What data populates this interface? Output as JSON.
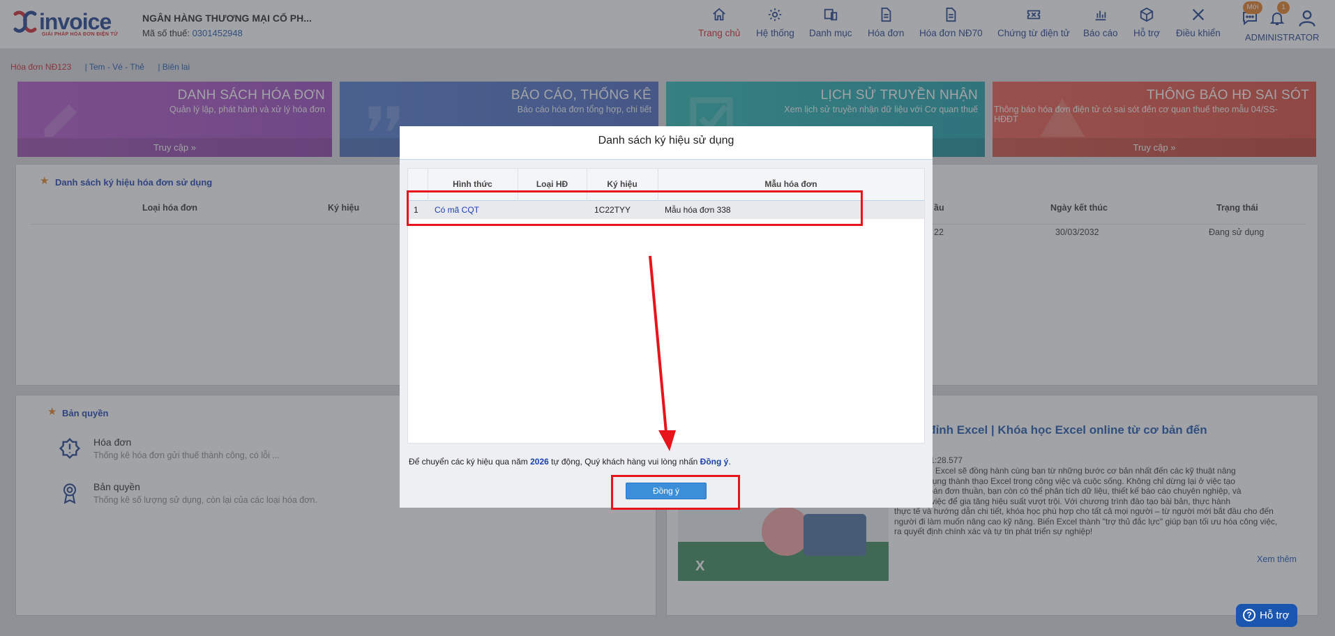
{
  "header": {
    "logo_text": "invoice",
    "logo_tagline": "GIẢI PHÁP HÓA ĐƠN ĐIỆN TỬ",
    "company_name": "NGÂN HÀNG THƯƠNG MẠI CỔ PH...",
    "tax_label": "Mã số thuế:",
    "tax_value": "0301452948",
    "nav": [
      {
        "label": "Trang chủ",
        "icon": "home-icon"
      },
      {
        "label": "Hệ thống",
        "icon": "gear-icon"
      },
      {
        "label": "Danh mục",
        "icon": "catalog-icon"
      },
      {
        "label": "Hóa đơn",
        "icon": "document-icon"
      },
      {
        "label": "Hóa đơn NĐ70",
        "icon": "document-icon"
      },
      {
        "label": "Chứng từ điện tử",
        "icon": "ticket-icon"
      },
      {
        "label": "Báo cáo",
        "icon": "bar-chart-icon"
      },
      {
        "label": "Hỗ trợ",
        "icon": "cube-icon"
      },
      {
        "label": "Điều khiển",
        "icon": "tools-icon"
      }
    ],
    "messages_badge": "Mới",
    "notifications_badge": "1",
    "user_label": "ADMINISTRATOR"
  },
  "tabs": [
    "Hóa đơn NĐ123",
    "| Tem - Vé - Thẻ",
    "| Biên lai"
  ],
  "tiles": [
    {
      "title": "DANH SÁCH HÓA ĐƠN",
      "desc": "Quản lý lập, phát hành và xử lý hóa đơn",
      "footer": "Truy cập",
      "color": "#a74fc4"
    },
    {
      "title": "BÁO CÁO, THỐNG KÊ",
      "desc": "Báo cáo hóa đơn tổng hợp, chi tiết",
      "footer": "",
      "color": "#4a70c6"
    },
    {
      "title": "LỊCH SỬ TRUYỀN NHẬN",
      "desc": "Xem lịch sử truyền nhận dữ liệu với Cơ quan thuế",
      "footer": "",
      "color": "#1fa9ae"
    },
    {
      "title": "THÔNG BÁO HĐ SAI SÓT",
      "desc": "Thông báo hóa đơn điện tử có sai sót đến cơ quan thuế theo mẫu 04/SS-HĐĐT",
      "footer": "Truy cập",
      "color": "#e1533f"
    }
  ],
  "symbols_panel": {
    "title": "Danh sách ký hiệu hóa đơn sử dụng",
    "columns": [
      "Loại hóa đơn",
      "Ký hiệu",
      "ầu",
      "Ngày kết thúc",
      "Trạng thái"
    ],
    "row": {
      "start_partial": "22",
      "end": "30/03/2032",
      "status": "Đang sử dụng"
    }
  },
  "license_panel": {
    "title": "Bản quyền",
    "items": [
      {
        "title": "Hóa đơn",
        "desc": "Thống kê hóa đơn gửi thuế thành công, có lỗi ..."
      },
      {
        "title": "Bản quyền",
        "desc": "Thống kê số lượng sử dụng, còn lại của các loại hóa đơn."
      }
    ]
  },
  "news": {
    "title": ": Tuyệt đỉnh Excel | Khóa học Excel online từ cơ bản đến\nao",
    "date": "04-29T14:51:28.577",
    "body": "Tuyệt đỉnh Excel sẽ đồng hành cùng bạn từ những bước cơ bản nhất đến các kỹ thuật nâng\nbán ứng dụng thành thạo Excel trong công việc và cuộc sống. Không chỉ dừng lại ở việc tạo\nhay tính toán đơn thuần, bạn còn có thể phân tích dữ liệu, thiết kế báo cáo chuyên nghiệp, và\nhóa công việc để gia tăng hiệu suất vượt trội. Với chương trình đào tạo bài bản, thực hành\nthực tế và hướng dẫn chi tiết, khóa học phù hợp cho tất cả mọi người – từ người mới bắt đầu cho đến\nngười đi làm muốn nâng cao kỹ năng. Biến Excel thành \"trợ thủ đắc lực\" giúp bạn tối ưu hóa công việc,\nra quyết định chính xác và tự tin phát triển sự nghiệp!",
    "more": "Xem thêm"
  },
  "modal": {
    "title": "Danh sách ký hiệu sử dụng",
    "columns": [
      "Hình thức",
      "Loại HĐ",
      "Ký hiệu",
      "Mẫu hóa đơn"
    ],
    "rows": [
      {
        "index": "1",
        "form": "Có mã CQT",
        "type": "",
        "symbol": "1C22TYY",
        "template": "Mẫu hóa đơn 338"
      }
    ],
    "note_prefix": "Để chuyển các ký hiệu qua năm ",
    "note_year": "2026",
    "note_middle": " tự động, Quý khách hàng vui lòng nhấn ",
    "note_action": "Đồng ý",
    "note_suffix": ".",
    "ok_label": "Đồng ý"
  },
  "help_button": "Hỗ trợ",
  "colors": {
    "brand": "#1b3c8f",
    "accent": "#d1232a",
    "annotation": "#e8141c",
    "button": "#3b8fd9"
  }
}
